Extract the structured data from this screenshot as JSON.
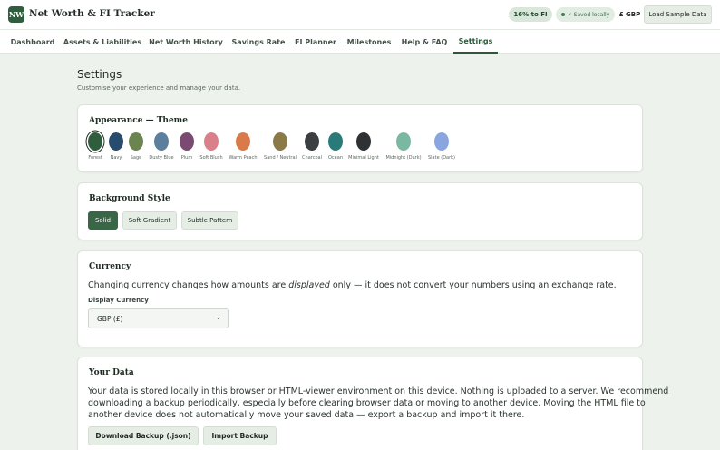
{
  "header": {
    "logo_text": "NW",
    "app_title": "Net Worth & FI Tracker",
    "fi_progress": "16% to FI",
    "saved_status": "✓ Saved locally",
    "currency_badge": "£ GBP",
    "load_sample_label": "Load Sample Data"
  },
  "nav": {
    "tabs": [
      {
        "label": "Dashboard"
      },
      {
        "label": "Assets & Liabilities"
      },
      {
        "label": "Net Worth History"
      },
      {
        "label": "Savings Rate"
      },
      {
        "label": "FI Planner"
      },
      {
        "label": "Milestones"
      },
      {
        "label": "Help & FAQ"
      },
      {
        "label": "Settings",
        "active": true
      }
    ]
  },
  "page": {
    "title": "Settings",
    "subtitle": "Customise your experience and manage your data."
  },
  "theme": {
    "title": "Appearance — Theme",
    "selected": "Forest",
    "swatches": [
      {
        "label": "Forest",
        "color": "#2f5d3e"
      },
      {
        "label": "Navy",
        "color": "#284b6e"
      },
      {
        "label": "Sage",
        "color": "#6b8450"
      },
      {
        "label": "Dusty Blue",
        "color": "#5b7f9c"
      },
      {
        "label": "Plum",
        "color": "#7a4a72"
      },
      {
        "label": "Soft Blush",
        "color": "#d9808a"
      },
      {
        "label": "Warm Peach",
        "color": "#d97a4a"
      },
      {
        "label": "Sand / Neutral",
        "color": "#8b7a48"
      },
      {
        "label": "Charcoal",
        "color": "#3b3f42"
      },
      {
        "label": "Ocean",
        "color": "#2a7a7a"
      },
      {
        "label": "Minimal Light",
        "color": "#2f3234"
      },
      {
        "label": "Midnight (Dark)",
        "color": "#7ab8a2"
      },
      {
        "label": "Slate (Dark)",
        "color": "#8aa6e0"
      }
    ]
  },
  "background": {
    "title": "Background Style",
    "options": [
      {
        "label": "Solid",
        "active": true
      },
      {
        "label": "Soft Gradient"
      },
      {
        "label": "Subtle Pattern"
      }
    ]
  },
  "currency": {
    "title": "Currency",
    "description_prefix": "Changing currency changes how amounts are ",
    "description_emphasis": "displayed",
    "description_suffix": " only — it does not convert your numbers using an exchange rate.",
    "field_label": "Display Currency",
    "selected_value": "GBP (£)"
  },
  "your_data": {
    "title": "Your Data",
    "description_line1": "Your data is stored locally in this browser or HTML-viewer environment on this device. Nothing is uploaded to a server. We recommend",
    "description_line2": "downloading a backup periodically, especially before clearing browser data or moving to another device. Moving the HTML file to",
    "description_line3": "another device does not automatically move your saved data — export a backup and import it there.",
    "download_label": "Download Backup (.json)",
    "import_label": "Import Backup"
  },
  "colors": {
    "brand": "#2f5d3e",
    "page_background": "#eef2ec",
    "active_button": "#386646"
  }
}
